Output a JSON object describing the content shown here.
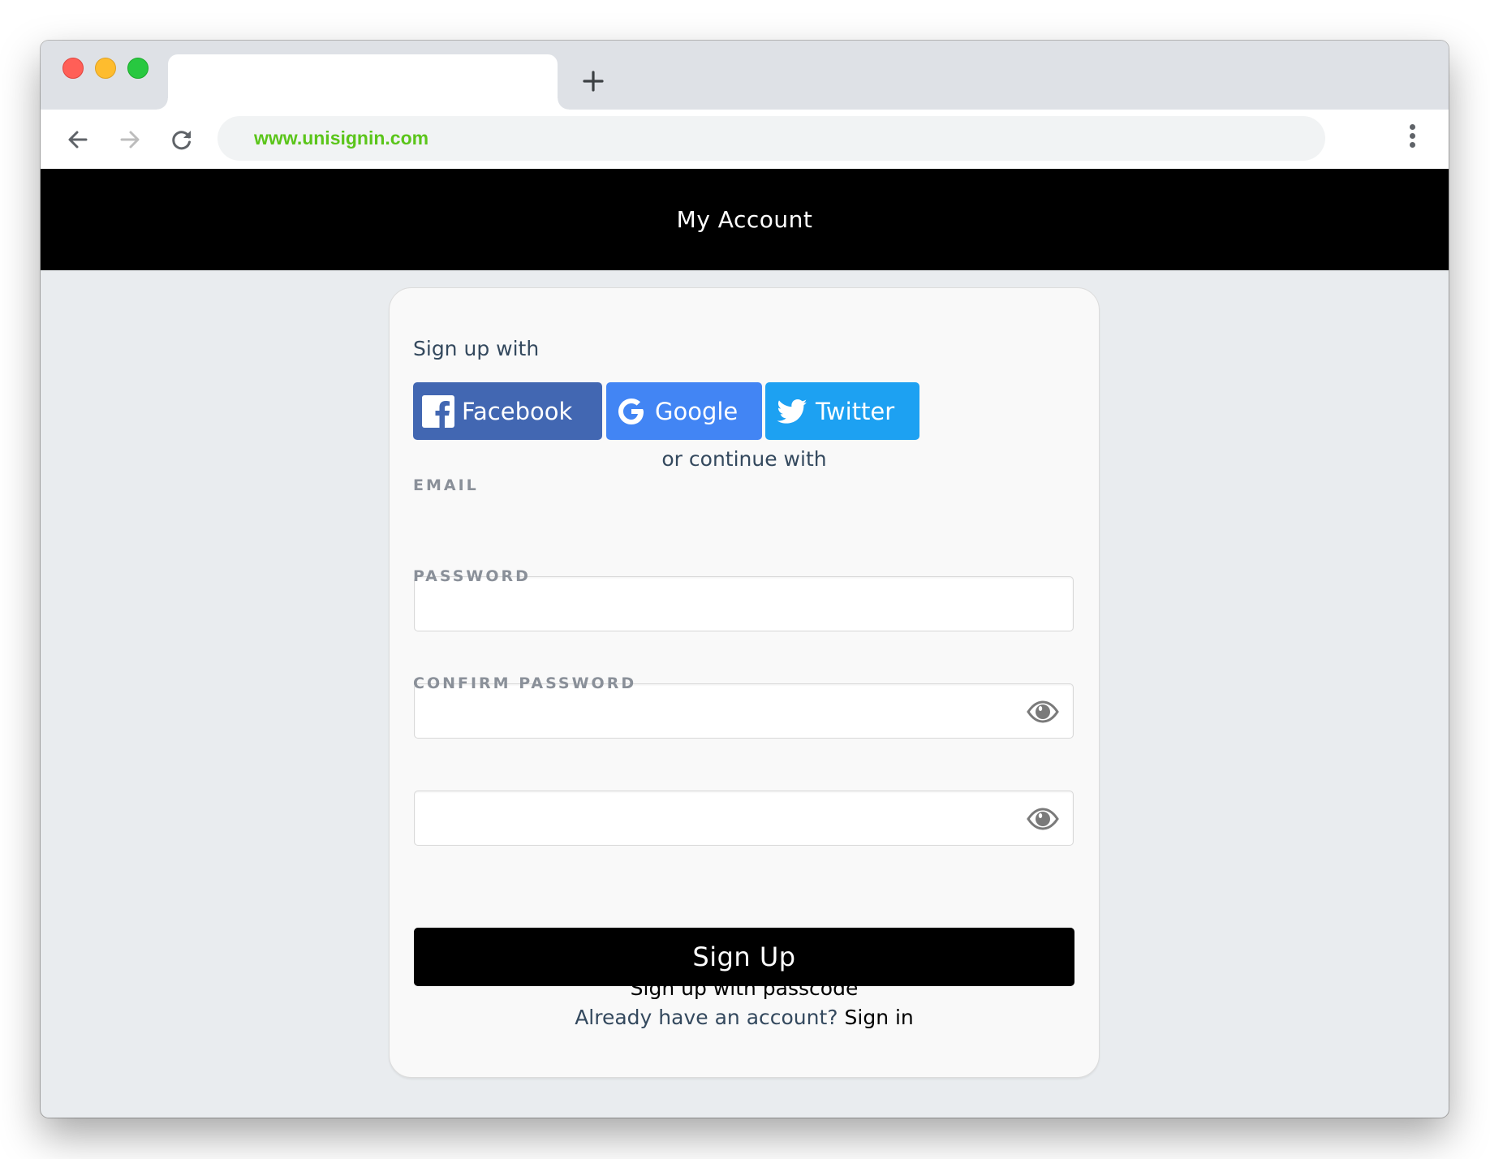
{
  "browser": {
    "tab_title": "",
    "new_tab_icon": "plus-icon",
    "url": "www.unisignin.com",
    "url_color": "#5bc51a",
    "nav": {
      "back_icon": "arrow-left-icon",
      "forward_icon": "arrow-right-icon",
      "reload_icon": "reload-icon",
      "menu_icon": "kebab-menu-icon"
    }
  },
  "header": {
    "title": "My Account"
  },
  "signup": {
    "social_heading": "Sign up with",
    "social_buttons": [
      {
        "label": "Facebook",
        "icon": "facebook-icon",
        "color": "#4267b2"
      },
      {
        "label": "Google",
        "icon": "google-icon",
        "color": "#4285f4"
      },
      {
        "label": "Twitter",
        "icon": "twitter-icon",
        "color": "#1da1f2"
      }
    ],
    "divider_text": "or continue with",
    "fields": {
      "email": {
        "label": "EMAIL",
        "value": "",
        "placeholder": ""
      },
      "password": {
        "label": "PASSWORD",
        "value": "",
        "placeholder": "",
        "toggle_icon": "eye-icon"
      },
      "confirm_password": {
        "label": "CONFIRM PASSWORD",
        "value": "",
        "placeholder": "",
        "toggle_icon": "eye-icon"
      }
    },
    "submit_label": "Sign Up",
    "passcode_link": "Sign up with passcode",
    "already_text": "Already have an account?",
    "signin_link": "Sign in"
  }
}
